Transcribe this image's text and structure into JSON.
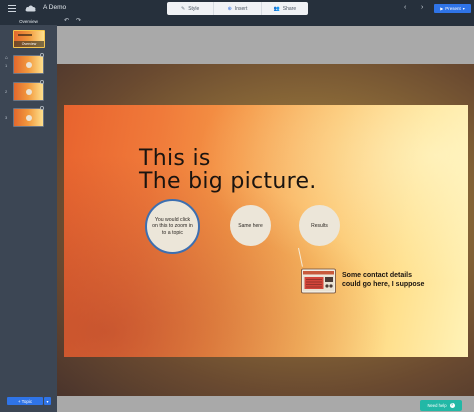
{
  "app": {
    "title": "A Demo"
  },
  "toolbar": {
    "tabs": [
      {
        "label": "Style",
        "icon": "brush-icon"
      },
      {
        "label": "Insert",
        "icon": "plus-circle-icon"
      },
      {
        "label": "Share",
        "icon": "people-icon"
      }
    ],
    "present_label": "Present"
  },
  "sidebar": {
    "header": "Overview",
    "overview_caption": "Overview",
    "topics": [
      {
        "number": "1"
      },
      {
        "number": "2"
      },
      {
        "number": "3"
      }
    ],
    "add_topic_label": "+ Topic"
  },
  "slide": {
    "heading_line1": "This is",
    "heading_line2": "The big picture.",
    "circles": [
      "You would click on this to zoom in to a topic",
      "Same here",
      "Results"
    ],
    "contact_text": "Some contact details could go here, I suppose"
  },
  "help": {
    "label": "Need help"
  },
  "colors": {
    "accent": "#2f74e8",
    "topbar": "#26303c",
    "sidebar": "#3c4654",
    "help": "#22b8a6",
    "circle_border": "#3d6fb0"
  }
}
